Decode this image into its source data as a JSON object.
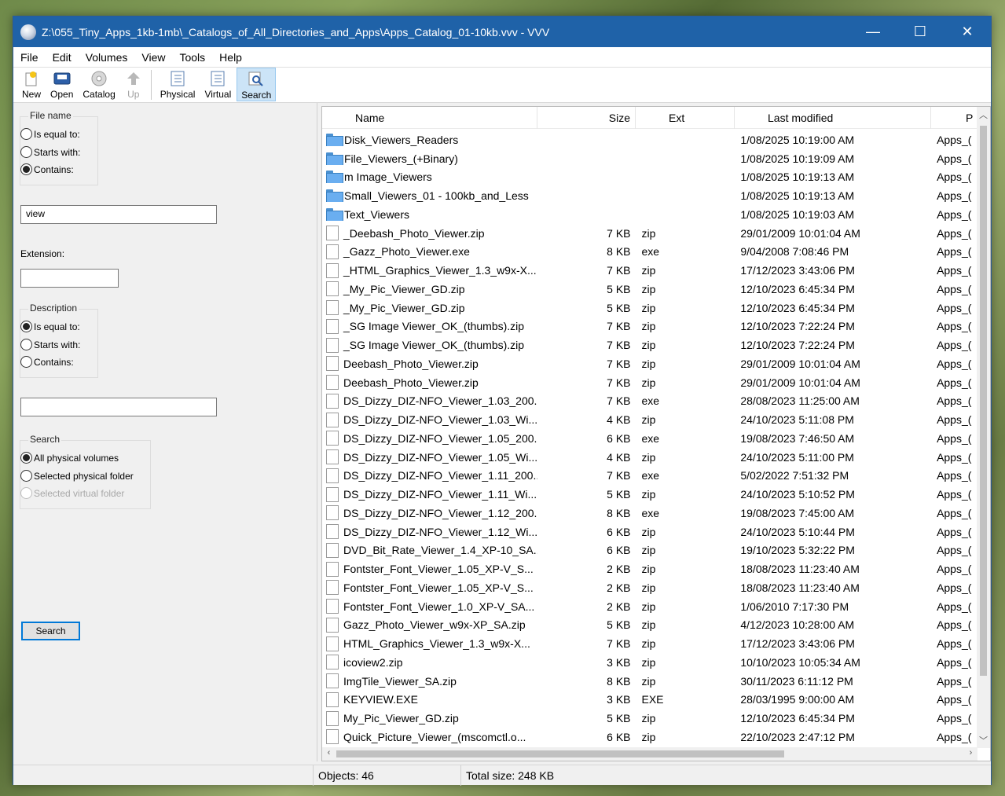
{
  "window": {
    "title": "Z:\\055_Tiny_Apps_1kb-1mb\\_Catalogs_of_All_Directories_and_Apps\\Apps_Catalog_01-10kb.vvv - VVV",
    "minimize_glyph": "—",
    "maximize_glyph": "☐",
    "close_glyph": "✕"
  },
  "menu": [
    "File",
    "Edit",
    "Volumes",
    "View",
    "Tools",
    "Help"
  ],
  "toolbar": {
    "new": "New",
    "open": "Open",
    "catalog": "Catalog",
    "up": "Up",
    "physical": "Physical",
    "virtual": "Virtual",
    "search": "Search"
  },
  "search_panel": {
    "filename_group": "File name",
    "filename_opts": [
      "Is equal to:",
      "Starts with:",
      "Contains:"
    ],
    "filename_value": "view",
    "extension_label": "Extension:",
    "extension_value": "",
    "description_group": "Description",
    "description_opts": [
      "Is equal to:",
      "Starts with:",
      "Contains:"
    ],
    "description_value": "",
    "search_group": "Search",
    "search_opts": [
      "All physical volumes",
      "Selected physical folder",
      "Selected virtual folder"
    ],
    "search_button": "Search"
  },
  "list": {
    "columns": [
      "Name",
      "Size",
      "Ext",
      "Last modified",
      "P"
    ],
    "rows": [
      {
        "name": "Disk_Viewers_Readers",
        "size": "",
        "ext": "",
        "modified": "1/08/2025 10:19:00 AM",
        "path": "Apps_(",
        "folder": true
      },
      {
        "name": "File_Viewers_(+Binary)",
        "size": "",
        "ext": "",
        "modified": "1/08/2025 10:19:09 AM",
        "path": "Apps_(",
        "folder": true
      },
      {
        "name": "m Image_Viewers",
        "size": "",
        "ext": "",
        "modified": "1/08/2025 10:19:13 AM",
        "path": "Apps_(",
        "folder": true
      },
      {
        "name": "Small_Viewers_01 - 100kb_and_Less",
        "size": "",
        "ext": "",
        "modified": "1/08/2025 10:19:13 AM",
        "path": "Apps_(",
        "folder": true
      },
      {
        "name": "Text_Viewers",
        "size": "",
        "ext": "",
        "modified": "1/08/2025 10:19:03 AM",
        "path": "Apps_(",
        "folder": true
      },
      {
        "name": "_Deebash_Photo_Viewer.zip",
        "size": "7 KB",
        "ext": "zip",
        "modified": "29/01/2009 10:01:04 AM",
        "path": "Apps_(",
        "folder": false
      },
      {
        "name": "_Gazz_Photo_Viewer.exe",
        "size": "8 KB",
        "ext": "exe",
        "modified": "9/04/2008 7:08:46 PM",
        "path": "Apps_(",
        "folder": false
      },
      {
        "name": "_HTML_Graphics_Viewer_1.3_w9x-X...",
        "size": "7 KB",
        "ext": "zip",
        "modified": "17/12/2023 3:43:06 PM",
        "path": "Apps_(",
        "folder": false
      },
      {
        "name": "_My_Pic_Viewer_GD.zip",
        "size": "5 KB",
        "ext": "zip",
        "modified": "12/10/2023 6:45:34 PM",
        "path": "Apps_(",
        "folder": false
      },
      {
        "name": "_My_Pic_Viewer_GD.zip",
        "size": "5 KB",
        "ext": "zip",
        "modified": "12/10/2023 6:45:34 PM",
        "path": "Apps_(",
        "folder": false
      },
      {
        "name": "_SG Image Viewer_OK_(thumbs).zip",
        "size": "7 KB",
        "ext": "zip",
        "modified": "12/10/2023 7:22:24 PM",
        "path": "Apps_(",
        "folder": false
      },
      {
        "name": "_SG Image Viewer_OK_(thumbs).zip",
        "size": "7 KB",
        "ext": "zip",
        "modified": "12/10/2023 7:22:24 PM",
        "path": "Apps_(",
        "folder": false
      },
      {
        "name": "Deebash_Photo_Viewer.zip",
        "size": "7 KB",
        "ext": "zip",
        "modified": "29/01/2009 10:01:04 AM",
        "path": "Apps_(",
        "folder": false
      },
      {
        "name": "Deebash_Photo_Viewer.zip",
        "size": "7 KB",
        "ext": "zip",
        "modified": "29/01/2009 10:01:04 AM",
        "path": "Apps_(",
        "folder": false
      },
      {
        "name": "DS_Dizzy_DIZ-NFO_Viewer_1.03_200...",
        "size": "7 KB",
        "ext": "exe",
        "modified": "28/08/2023 11:25:00 AM",
        "path": "Apps_(",
        "folder": false
      },
      {
        "name": "DS_Dizzy_DIZ-NFO_Viewer_1.03_Wi...",
        "size": "4 KB",
        "ext": "zip",
        "modified": "24/10/2023 5:11:08 PM",
        "path": "Apps_(",
        "folder": false
      },
      {
        "name": "DS_Dizzy_DIZ-NFO_Viewer_1.05_200...",
        "size": "6 KB",
        "ext": "exe",
        "modified": "19/08/2023 7:46:50 AM",
        "path": "Apps_(",
        "folder": false
      },
      {
        "name": "DS_Dizzy_DIZ-NFO_Viewer_1.05_Wi...",
        "size": "4 KB",
        "ext": "zip",
        "modified": "24/10/2023 5:11:00 PM",
        "path": "Apps_(",
        "folder": false
      },
      {
        "name": "DS_Dizzy_DIZ-NFO_Viewer_1.11_200...",
        "size": "7 KB",
        "ext": "exe",
        "modified": "5/02/2022 7:51:32 PM",
        "path": "Apps_(",
        "folder": false
      },
      {
        "name": "DS_Dizzy_DIZ-NFO_Viewer_1.11_Wi...",
        "size": "5 KB",
        "ext": "zip",
        "modified": "24/10/2023 5:10:52 PM",
        "path": "Apps_(",
        "folder": false
      },
      {
        "name": "DS_Dizzy_DIZ-NFO_Viewer_1.12_200...",
        "size": "8 KB",
        "ext": "exe",
        "modified": "19/08/2023 7:45:00 AM",
        "path": "Apps_(",
        "folder": false
      },
      {
        "name": "DS_Dizzy_DIZ-NFO_Viewer_1.12_Wi...",
        "size": "6 KB",
        "ext": "zip",
        "modified": "24/10/2023 5:10:44 PM",
        "path": "Apps_(",
        "folder": false
      },
      {
        "name": "DVD_Bit_Rate_Viewer_1.4_XP-10_SA...",
        "size": "6 KB",
        "ext": "zip",
        "modified": "19/10/2023 5:32:22 PM",
        "path": "Apps_(",
        "folder": false
      },
      {
        "name": "Fontster_Font_Viewer_1.05_XP-V_S...",
        "size": "2 KB",
        "ext": "zip",
        "modified": "18/08/2023 11:23:40 AM",
        "path": "Apps_(",
        "folder": false
      },
      {
        "name": "Fontster_Font_Viewer_1.05_XP-V_S...",
        "size": "2 KB",
        "ext": "zip",
        "modified": "18/08/2023 11:23:40 AM",
        "path": "Apps_(",
        "folder": false
      },
      {
        "name": "Fontster_Font_Viewer_1.0_XP-V_SA...",
        "size": "2 KB",
        "ext": "zip",
        "modified": "1/06/2010 7:17:30 PM",
        "path": "Apps_(",
        "folder": false
      },
      {
        "name": "Gazz_Photo_Viewer_w9x-XP_SA.zip",
        "size": "5 KB",
        "ext": "zip",
        "modified": "4/12/2023 10:28:00 AM",
        "path": "Apps_(",
        "folder": false
      },
      {
        "name": "HTML_Graphics_Viewer_1.3_w9x-X...",
        "size": "7 KB",
        "ext": "zip",
        "modified": "17/12/2023 3:43:06 PM",
        "path": "Apps_(",
        "folder": false
      },
      {
        "name": "icoview2.zip",
        "size": "3 KB",
        "ext": "zip",
        "modified": "10/10/2023 10:05:34 AM",
        "path": "Apps_(",
        "folder": false
      },
      {
        "name": "ImgTile_Viewer_SA.zip",
        "size": "8 KB",
        "ext": "zip",
        "modified": "30/11/2023 6:11:12 PM",
        "path": "Apps_(",
        "folder": false
      },
      {
        "name": "KEYVIEW.EXE",
        "size": "3 KB",
        "ext": "EXE",
        "modified": "28/03/1995 9:00:00 AM",
        "path": "Apps_(",
        "folder": false
      },
      {
        "name": "My_Pic_Viewer_GD.zip",
        "size": "5 KB",
        "ext": "zip",
        "modified": "12/10/2023 6:45:34 PM",
        "path": "Apps_(",
        "folder": false
      },
      {
        "name": "Quick_Picture_Viewer_(mscomctl.o...",
        "size": "6 KB",
        "ext": "zip",
        "modified": "22/10/2023 2:47:12 PM",
        "path": "Apps_(",
        "folder": false
      }
    ]
  },
  "status": {
    "objects": "Objects: 46",
    "total_size": "Total size: 248 KB"
  }
}
